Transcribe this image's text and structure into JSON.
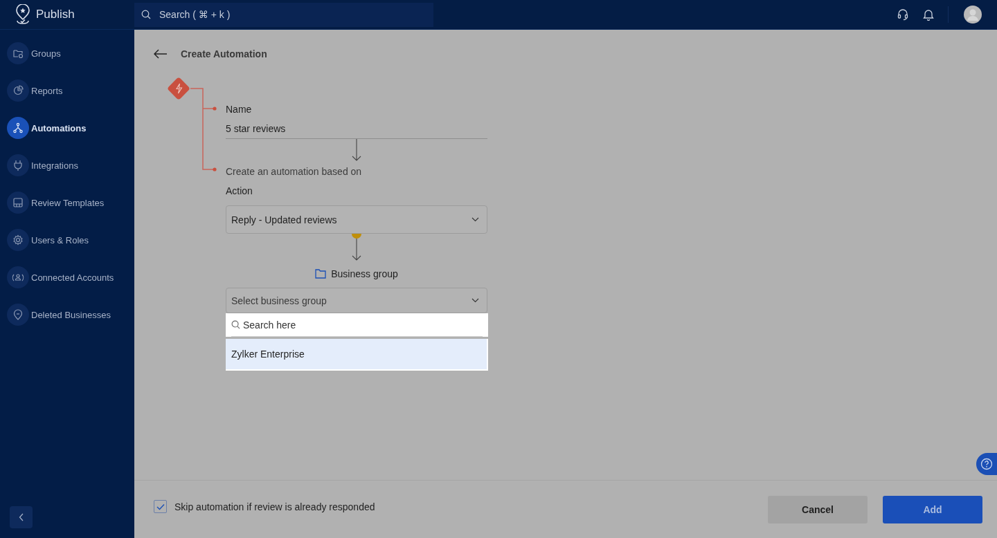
{
  "app": {
    "name": "Publish"
  },
  "search": {
    "placeholder": "Search ( ⌘ + k )"
  },
  "sidebar": {
    "items": [
      {
        "label": "Groups",
        "selected": false
      },
      {
        "label": "Reports",
        "selected": false
      },
      {
        "label": "Automations",
        "selected": true
      },
      {
        "label": "Integrations",
        "selected": false
      },
      {
        "label": "Review Templates",
        "selected": false
      },
      {
        "label": "Users & Roles",
        "selected": false
      },
      {
        "label": "Connected Accounts",
        "selected": false
      },
      {
        "label": "Deleted Businesses",
        "selected": false
      }
    ]
  },
  "page": {
    "title": "Create Automation"
  },
  "form": {
    "name_label": "Name",
    "name_value": "5 star reviews",
    "based_on_label": "Create an automation based on",
    "action_label": "Action",
    "action_value": "Reply - Updated reviews",
    "group_label": "Business group",
    "group_placeholder": "Select business group",
    "dropdown": {
      "search_placeholder": "Search here",
      "options": [
        {
          "label": "Zylker Enterprise",
          "selected": true
        }
      ]
    }
  },
  "footer": {
    "skip": {
      "label": "Skip automation if review is already responded",
      "checked": true
    },
    "buttons": [
      {
        "label": "Cancel",
        "kind": "secondary"
      },
      {
        "label": "Add",
        "kind": "primary"
      }
    ]
  }
}
